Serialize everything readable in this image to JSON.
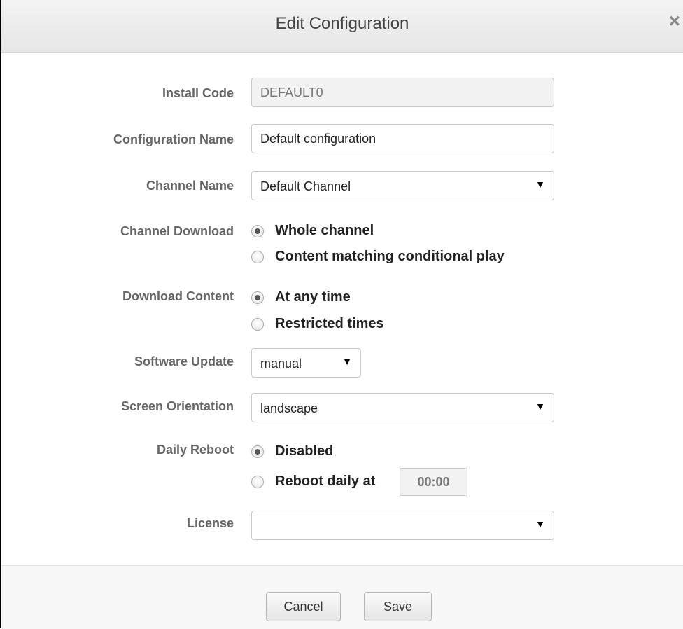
{
  "dialog": {
    "title": "Edit Configuration",
    "close_glyph": "×"
  },
  "form": {
    "install_code": {
      "label": "Install Code",
      "value": "DEFAULT0"
    },
    "configuration_name": {
      "label": "Configuration Name",
      "value": "Default configuration"
    },
    "channel_name": {
      "label": "Channel Name",
      "value": "Default Channel"
    },
    "channel_download": {
      "label": "Channel Download",
      "options": [
        "Whole channel",
        "Content matching conditional play"
      ],
      "selected": "Whole channel"
    },
    "download_content": {
      "label": "Download Content",
      "options": [
        "At any time",
        "Restricted times"
      ],
      "selected": "At any time"
    },
    "software_update": {
      "label": "Software Update",
      "value": "manual"
    },
    "screen_orientation": {
      "label": "Screen Orientation",
      "value": "landscape"
    },
    "daily_reboot": {
      "label": "Daily Reboot",
      "options": [
        "Disabled",
        "Reboot daily at"
      ],
      "selected": "Disabled",
      "time": "00:00"
    },
    "license": {
      "label": "License",
      "value": ""
    }
  },
  "footer": {
    "cancel_label": "Cancel",
    "save_label": "Save"
  },
  "icons": {
    "dropdown_arrow": "▼"
  }
}
